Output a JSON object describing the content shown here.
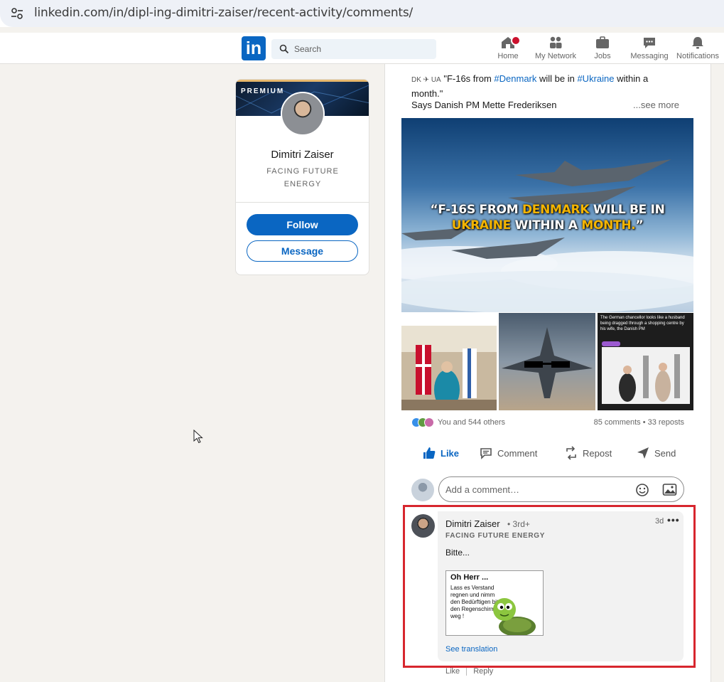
{
  "browser": {
    "url": "linkedin.com/in/dipl-ing-dimitri-zaiser/recent-activity/comments/"
  },
  "nav": {
    "logo": "in",
    "search_placeholder": "Search",
    "items": [
      {
        "label": "Home",
        "icon": "home-icon"
      },
      {
        "label": "My Network",
        "icon": "network-icon"
      },
      {
        "label": "Jobs",
        "icon": "briefcase-icon"
      },
      {
        "label": "Messaging",
        "icon": "messaging-icon"
      },
      {
        "label": "Notifications",
        "icon": "bell-icon"
      }
    ]
  },
  "profile": {
    "badge": "PREMIUM",
    "name": "Dimitri Zaiser",
    "headline": "FACING FUTURE ENERGY",
    "follow_label": "Follow",
    "message_label": "Message"
  },
  "post": {
    "flags_prefix": "DK ✈ UA",
    "text_before": " \"F-16s from ",
    "tag1": "#Denmark",
    "text_mid": " will be in ",
    "tag2": "#Ukraine",
    "text_after": " within a month.\"",
    "line2": "Says Danish PM Mette Frederiksen",
    "see_more": "...see more",
    "image_caption_1": "“F-16S FROM ",
    "image_caption_hl1": "DENMARK",
    "image_caption_2": " WILL BE IN",
    "image_caption_hl2": "UKRAINE",
    "image_caption_3": " WITHIN A ",
    "image_caption_hl3": "MONTH.",
    "image_caption_4": "”",
    "thumb3_caption": "The German chancellor looks like a husband being dragged through a shopping centre by his wife, the Danish PM",
    "reactions_text": "You and 544 others",
    "stats_text": "85 comments • 33 reposts",
    "actions": {
      "like": "Like",
      "comment": "Comment",
      "repost": "Repost",
      "send": "Send"
    },
    "add_comment_placeholder": "Add a comment…"
  },
  "comment": {
    "author": "Dimitri Zaiser",
    "degree": "• 3rd+",
    "time": "3d",
    "more": "•••",
    "headline": "FACING FUTURE ENERGY",
    "body": "Bitte...",
    "meme_title": "Oh Herr ...",
    "meme_body": "Lass es Verstand regnen und nimm den Bedürftigen bitte den Regenschirm weg !",
    "see_translation": "See translation",
    "like": "Like",
    "reply": "Reply"
  },
  "colors": {
    "brand": "#0a66c2",
    "highlight_border": "#d7262e",
    "notification_badge": "#cb112d"
  }
}
